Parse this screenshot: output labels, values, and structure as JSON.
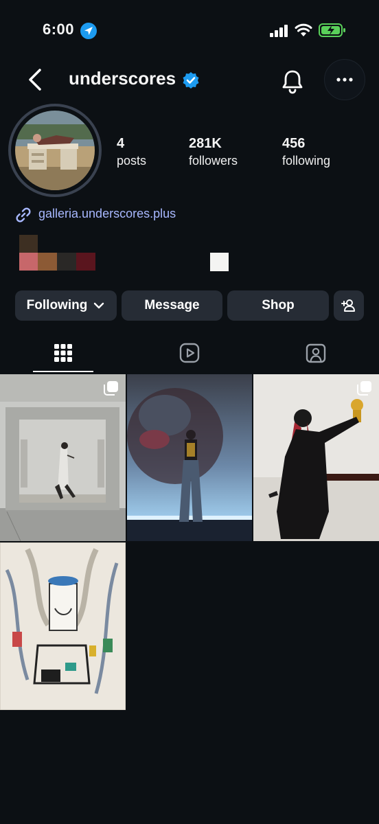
{
  "status_bar": {
    "time": "6:00"
  },
  "header": {
    "username": "underscores"
  },
  "profile": {
    "stats": [
      {
        "value": "4",
        "label": "posts"
      },
      {
        "value": "281K",
        "label": "followers"
      },
      {
        "value": "456",
        "label": "following"
      }
    ],
    "link": "galleria.underscores.plus"
  },
  "actions": {
    "following_label": "Following",
    "message_label": "Message",
    "shop_label": "Shop"
  },
  "colors": {
    "background": "#0c1014",
    "button": "#262c35",
    "link": "#a8b8ff",
    "verified": "#1d9bf0",
    "battery": "#5ad05a",
    "swatches": [
      "#3d2f22",
      "#c7676a",
      "#8c5a35",
      "#2a2826",
      "#5a151e",
      "#f4f4f2"
    ]
  },
  "tabs": [
    {
      "name": "posts-grid-icon",
      "active": true
    },
    {
      "name": "reels-icon",
      "active": false
    },
    {
      "name": "tagged-icon",
      "active": false
    }
  ],
  "posts": [
    {
      "description_icon": "multi-image-icon"
    },
    {
      "description_icon": "none"
    },
    {
      "description_icon": "multi-image-icon"
    },
    {
      "description_icon": "none"
    }
  ]
}
